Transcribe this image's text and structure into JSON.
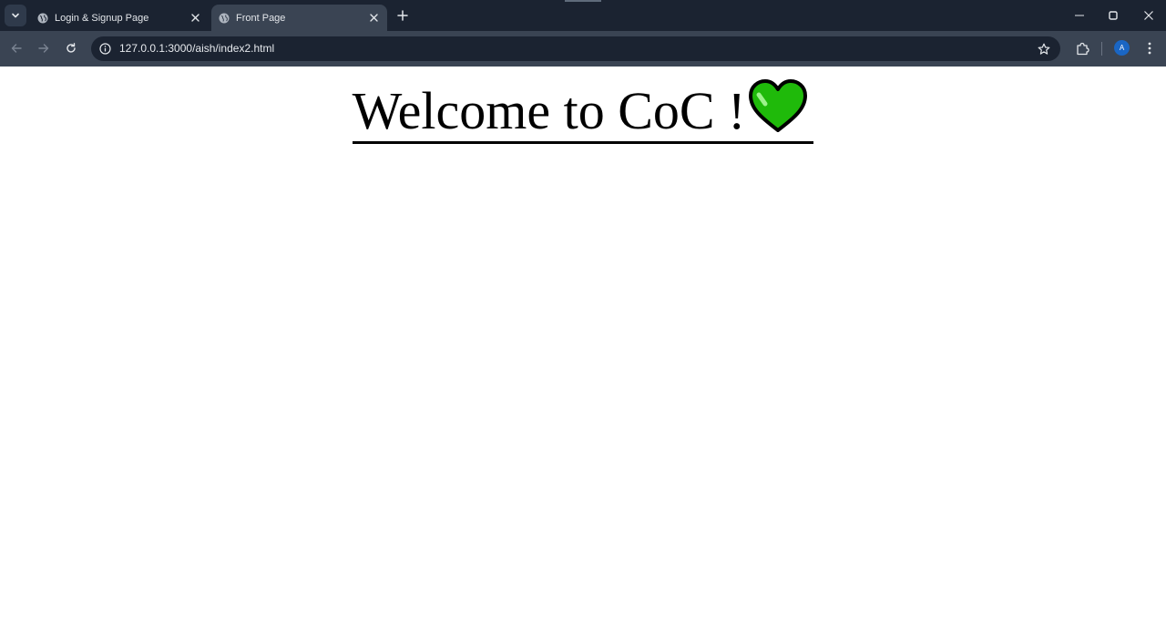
{
  "browser": {
    "tabs": [
      {
        "title": "Login & Signup Page",
        "active": false
      },
      {
        "title": "Front Page",
        "active": true
      }
    ],
    "url": "127.0.0.1:3000/aish/index2.html",
    "profile_initial": "A"
  },
  "page": {
    "heading": "Welcome to CoC !",
    "heading_emoji": "green-heart",
    "heart_color": "#1fba0a"
  },
  "colors": {
    "tabstrip_bg": "#1b2331",
    "toolbar_bg": "#3a4453",
    "avatar_bg": "#1a66c4"
  }
}
